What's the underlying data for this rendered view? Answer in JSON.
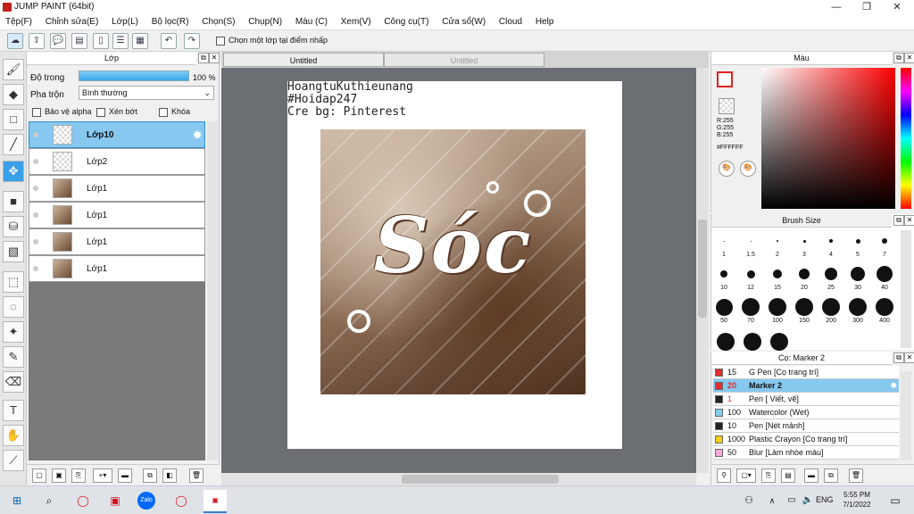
{
  "window": {
    "title": "JUMP PAINT (64bit)"
  },
  "menu": [
    "Tệp(F)",
    "Chỉnh sửa(E)",
    "Lớp(L)",
    "Bộ lọc(R)",
    "Chọn(S)",
    "Chụp(N)",
    "Màu (C)",
    "Xem(V)",
    "Công cụ(T)",
    "Cửa sổ(W)",
    "Cloud",
    "Help"
  ],
  "toolbar": {
    "select_layer_label": "Chọn một lớp tại điểm nhấp"
  },
  "layer_panel": {
    "title": "Lớp",
    "opacity_label": "Độ trong",
    "opacity_value": "100 %",
    "opacity_fraction": 1.0,
    "blend_label": "Pha trộn",
    "blend_value": "Bình thường",
    "protect_alpha": "Bảo vệ alpha",
    "clipping": "Xén bớt",
    "lock": "Khóa",
    "layers": [
      "Lớp10",
      "Lớp2",
      "Lớp1",
      "Lớp1",
      "Lớp1",
      "Lớp1"
    ]
  },
  "canvas": {
    "tabs": [
      "Untitled",
      "Untitled"
    ],
    "overlay_lines": [
      "HoangtuKuthieunang",
      "#Hoidap247",
      "Cre bg: Pinterest"
    ],
    "art_word": "Sóc"
  },
  "color_panel": {
    "title": "Màu",
    "r": "R:255",
    "g": "G:255",
    "b": "B:255",
    "hex": "#FFFFFF"
  },
  "brush_panel": {
    "title": "Brush Size",
    "sizes": [
      "1",
      "1.5",
      "2",
      "3",
      "4",
      "5",
      "7",
      "10",
      "12",
      "15",
      "20",
      "25",
      "30",
      "40",
      "50",
      "70",
      "100",
      "150",
      "200",
      "300",
      "400"
    ]
  },
  "sub_tool": {
    "title": "Cọ: Marker 2",
    "items": [
      {
        "size": "15",
        "label": "G Pen [Cọ trang trí]",
        "color": "#e03030"
      },
      {
        "size": "20",
        "label": "Marker 2",
        "color": "#e03030"
      },
      {
        "size": "1",
        "label": "Pen [ Viết, vẽ]",
        "color": "#222222"
      },
      {
        "size": "100",
        "label": "Watercolor (Wet)",
        "color": "#7fd0ee"
      },
      {
        "size": "10",
        "label": "Pen [Nét mảnh]",
        "color": "#222222"
      },
      {
        "size": "1000",
        "label": "Plastic Crayon [Cọ trang trí]",
        "color": "#f0d020"
      },
      {
        "size": "50",
        "label": "Blur [Làm nhòe màu]",
        "color": "#f6a8d8"
      }
    ]
  },
  "taskbar": {
    "lang": "ENG",
    "time": "5:55 PM",
    "date": "7/1/2022"
  }
}
